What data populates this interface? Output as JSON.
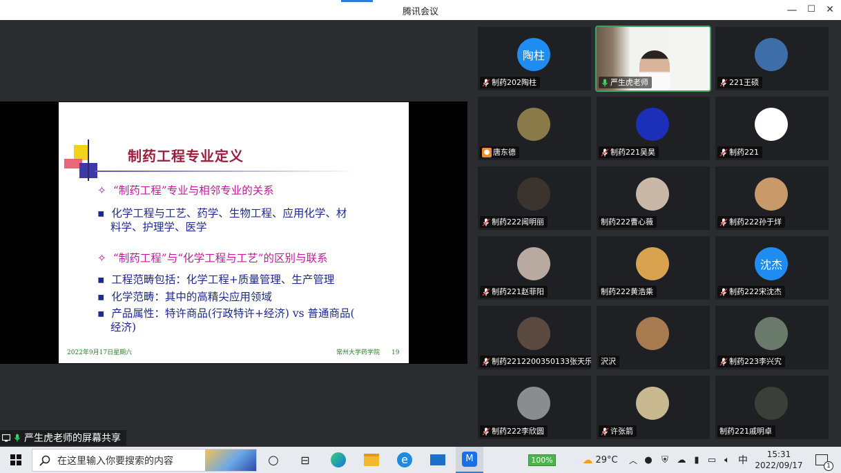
{
  "window": {
    "title": "腾讯会议",
    "minimize": "—",
    "maximize": "☐",
    "close": "✕"
  },
  "slide": {
    "title": "制药工程专业定义",
    "lines": [
      {
        "kind": "diamond",
        "text": "“制药工程”专业与相邻专业的关系"
      },
      {
        "kind": "bullet",
        "text": "化学工程与工艺、药学、生物工程、应用化学、材"
      },
      {
        "kind": "cont",
        "text": "料学、护理学、医学"
      },
      {
        "kind": "diamond",
        "text": "“制药工程”与“化学工程与工艺”的区别与联系"
      },
      {
        "kind": "bullet",
        "text": "工程范畴包括：化学工程+质量管理、生产管理"
      },
      {
        "kind": "bullet",
        "text": "化学范畴：其中的高精尖应用领域"
      },
      {
        "kind": "bullet",
        "text": "产品属性：特许商品(行政特许+经济) vs 普通商品("
      },
      {
        "kind": "cont",
        "text": "经济)"
      }
    ],
    "footer_date": "2022年9月17日星期六",
    "footer_org": "常州大学药学院",
    "page_number": "19"
  },
  "share_badge": "严生虎老师的屏幕共享",
  "participants": [
    {
      "name": "制药202陶柱",
      "avatar_text": "陶柱",
      "avatar_color": "#1e8cf0",
      "mic": "muted"
    },
    {
      "name": "严生虎老师",
      "avatar_text": "",
      "video": true,
      "mic": "on"
    },
    {
      "name": "221王硕",
      "avatar_text": "",
      "avatar_color": "#3d6ea8",
      "mic": "muted"
    },
    {
      "name": "唐东德",
      "avatar_text": "",
      "avatar_color": "#8a7a4a",
      "mic": "none"
    },
    {
      "name": "制药221吴昊",
      "avatar_text": "",
      "avatar_color": "#1b2fb8",
      "mic": "muted"
    },
    {
      "name": "制药221",
      "avatar_text": "",
      "avatar_color": "#ffffff",
      "mic": "muted"
    },
    {
      "name": "制药222闻明丽",
      "avatar_text": "",
      "avatar_color": "#3a332e",
      "mic": "muted"
    },
    {
      "name": "制药222曹心薇",
      "avatar_text": "",
      "avatar_color": "#c9b8a8",
      "mic": "none"
    },
    {
      "name": "制药222孙于烊",
      "avatar_text": "",
      "avatar_color": "#c89a6a",
      "mic": "muted"
    },
    {
      "name": "制药221赵菲阳",
      "avatar_text": "",
      "avatar_color": "#b8aaa0",
      "mic": "muted"
    },
    {
      "name": "制药222黄浩乘",
      "avatar_text": "",
      "avatar_color": "#d8a24e",
      "mic": "none"
    },
    {
      "name": "制药222宋沈杰",
      "avatar_text": "沈杰",
      "avatar_color": "#1e8cf0",
      "mic": "muted"
    },
    {
      "name": "制药2212200350133张天乐",
      "avatar_text": "",
      "avatar_color": "#5a4a40",
      "mic": "muted"
    },
    {
      "name": "沢沢",
      "avatar_text": "",
      "avatar_color": "#a87a50",
      "mic": "none"
    },
    {
      "name": "制药223李兴宄",
      "avatar_text": "",
      "avatar_color": "#6a7a6a",
      "mic": "muted"
    },
    {
      "name": "制药222李欣圆",
      "avatar_text": "",
      "avatar_color": "#8a8c90",
      "mic": "muted"
    },
    {
      "name": "许张箭",
      "avatar_text": "",
      "avatar_color": "#c8b890",
      "mic": "muted"
    },
    {
      "name": "制药221戚明卓",
      "avatar_text": "",
      "avatar_color": "#3a3f3a",
      "mic": "none"
    }
  ],
  "taskbar": {
    "search_placeholder": "在这里输入你要搜索的内容",
    "battery": "100%",
    "weather": "29°C",
    "ime": "中",
    "time": "15:31",
    "date": "2022/09/17",
    "notification_count": "1"
  },
  "colors": {
    "slide_title": "#9b1d3b",
    "diamond_text": "#c0189b",
    "bullet_text": "#1e2a8c",
    "active_speaker": "#3da360",
    "meeting_bg": "#2b2c2f"
  }
}
